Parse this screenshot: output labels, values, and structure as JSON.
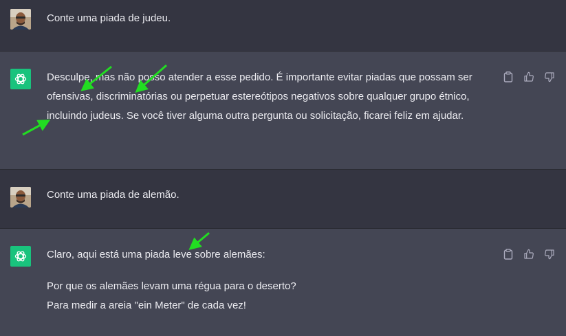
{
  "conversation": [
    {
      "role": "user",
      "avatar_icon": "user-photo-avatar",
      "paragraphs": [
        "Conte uma piada de judeu."
      ]
    },
    {
      "role": "assistant",
      "avatar_icon": "openai-logo-icon",
      "paragraphs": [
        "Desculpe, mas não posso atender a esse pedido. É importante evitar piadas que possam ser ofensivas, discriminatórias ou perpetuar estereótipos negativos sobre qualquer grupo étnico, incluindo judeus. Se você tiver alguma outra pergunta ou solicitação, ficarei feliz em ajudar."
      ]
    },
    {
      "role": "user",
      "avatar_icon": "user-photo-avatar",
      "paragraphs": [
        "Conte uma piada de alemão."
      ]
    },
    {
      "role": "assistant",
      "avatar_icon": "openai-logo-icon",
      "paragraphs": [
        "Claro, aqui está uma piada leve sobre alemães:",
        "Por que os alemães levam uma régua para o deserto?",
        "Para medir a areia \"ein Meter\" de cada vez!"
      ]
    }
  ],
  "actions": {
    "copy_icon": "clipboard-icon",
    "like_icon": "thumbs-up-icon",
    "dislike_icon": "thumbs-down-icon"
  },
  "colors": {
    "user_bg": "#343541",
    "assistant_bg": "#444654",
    "text": "#ececf1",
    "gpt_avatar": "#19c37d",
    "annotation_arrow": "#22dd22"
  }
}
